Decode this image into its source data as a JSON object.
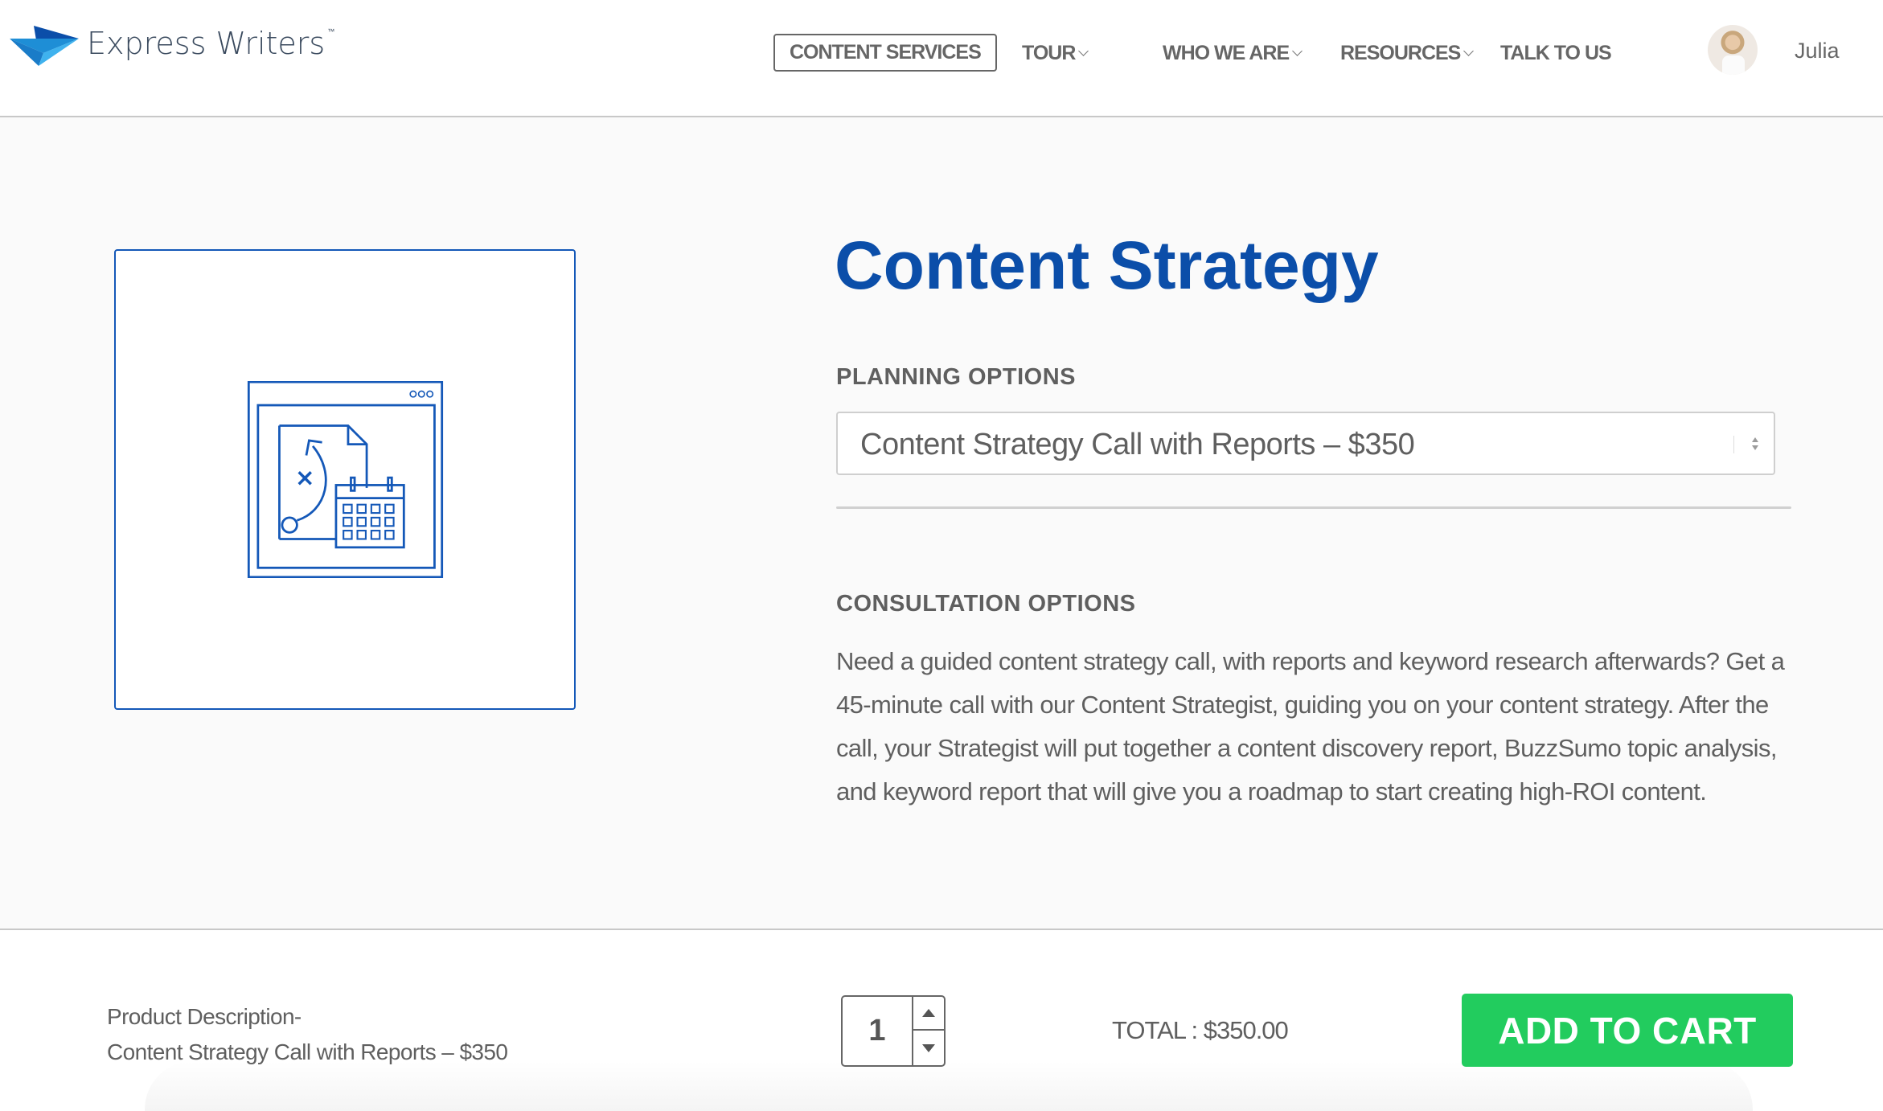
{
  "header": {
    "logo_text": "Express Writers",
    "logo_tm": "™",
    "nav": [
      {
        "label": "CONTENT SERVICES",
        "has_dropdown": false,
        "active": true
      },
      {
        "label": "TOUR",
        "has_dropdown": true
      },
      {
        "label": "WHO WE ARE",
        "has_dropdown": true
      },
      {
        "label": "RESOURCES",
        "has_dropdown": true
      },
      {
        "label": "TALK TO US",
        "has_dropdown": false
      }
    ],
    "user": {
      "name": "Julia",
      "avatar_icon": "user-photo"
    }
  },
  "product": {
    "image_icon": "strategy-calendar-illustration",
    "title": "Content Strategy",
    "planning_label": "PLANNING OPTIONS",
    "planning_selected": "Content Strategy Call with Reports – $350",
    "consultation_label": "CONSULTATION OPTIONS",
    "consultation_description": "Need a guided content strategy call, with reports and keyword research afterwards? Get a 45-minute call with our Content Strategist, guiding you on your content strategy. After the call, your Strategist will put together a content discovery report, BuzzSumo topic analysis, and keyword report that will give you a roadmap to start creating high-ROI content."
  },
  "cart": {
    "desc_label": "Product Description-",
    "desc_value": "Content Strategy Call with Reports – $350",
    "quantity": "1",
    "total": "TOTAL : $350.00",
    "add_to_cart_label": "ADD TO CART"
  },
  "colors": {
    "brand_blue": "#0b4ea9",
    "illustration_blue": "#1458b8",
    "cta_green": "#22cc5e",
    "text_gray": "#5f5f5f"
  }
}
